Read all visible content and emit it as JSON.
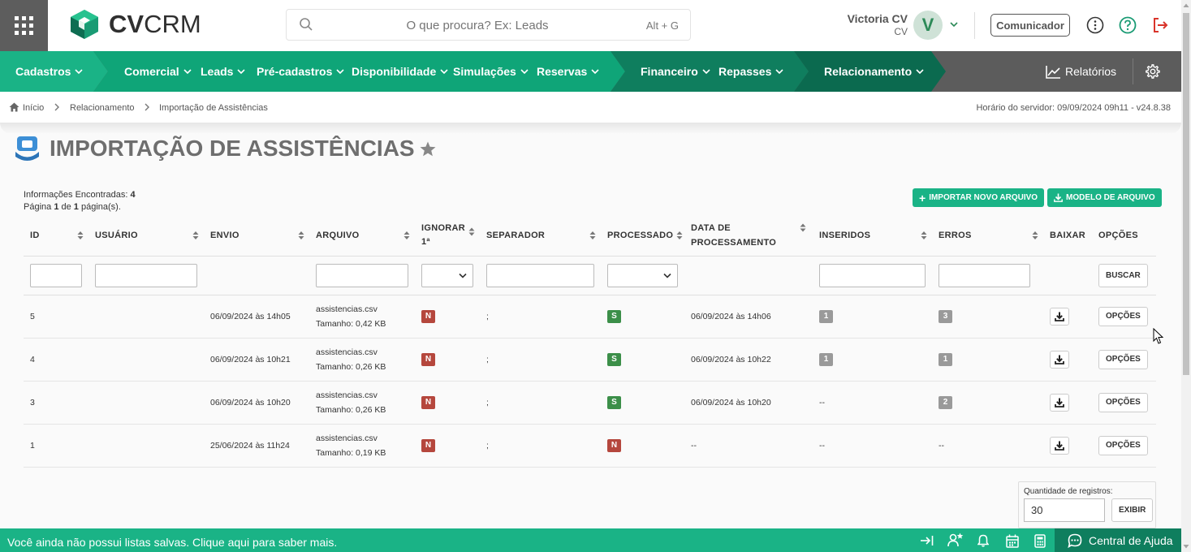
{
  "header": {
    "logo_text_bold": "CV",
    "logo_text_thin": "CRM",
    "search_placeholder": "O que procura? Ex: Leads",
    "search_shortcut": "Alt + G",
    "user_name": "Victoria CV",
    "user_sub": "CV",
    "avatar_letter": "V",
    "comunicador_label": "Comunicador"
  },
  "nav": {
    "cadastros": "Cadastros",
    "comercial": "Comercial",
    "leads": "Leads",
    "pre_cadastros": "Pré-cadastros",
    "disponibilidade": "Disponibilidade",
    "simulacoes": "Simulações",
    "reservas": "Reservas",
    "financeiro": "Financeiro",
    "repasses": "Repasses",
    "relacionamento": "Relacionamento",
    "relatorios": "Relatórios"
  },
  "breadcrumb": {
    "home": "Início",
    "section": "Relacionamento",
    "current": "Importação de Assistências",
    "server_time": "Horário do servidor: 09/09/2024 09h11 - v24.8.38"
  },
  "page": {
    "title": "IMPORTAÇÃO DE ASSISTÊNCIAS",
    "info_label": "Informações Encontradas: ",
    "info_count": "4",
    "page_prefix": "Página ",
    "page_num": "1",
    "page_mid": " de ",
    "page_total": "1",
    "page_suffix": " página(s).",
    "btn_import": "IMPORTAR NOVO ARQUIVO",
    "btn_model": "MODELO DE ARQUIVO"
  },
  "table": {
    "headers": {
      "id": "ID",
      "usuario": "USUÁRIO",
      "envio": "ENVIO",
      "arquivo": "ARQUIVO",
      "ignorar": "IGNORAR 1ª",
      "separador": "SEPARADOR",
      "processado": "PROCESSADO",
      "data_proc": "DATA DE PROCESSAMENTO",
      "inseridos": "INSERIDOS",
      "erros": "ERROS",
      "baixar": "BAIXAR",
      "opcoes": "OPÇÕES"
    },
    "buscar_label": "BUSCAR",
    "opcoes_label": "OPÇÕES",
    "rows": [
      {
        "id": "5",
        "envio": "06/09/2024 às 14h05",
        "arquivo": "assistencias.csv",
        "tamanho": "Tamanho: 0,42 KB",
        "ignorar": "N",
        "separador": ";",
        "processado": "S",
        "data_proc": "06/09/2024 às 14h06",
        "inseridos": "1",
        "erros": "3"
      },
      {
        "id": "4",
        "envio": "06/09/2024 às 10h21",
        "arquivo": "assistencias.csv",
        "tamanho": "Tamanho: 0,26 KB",
        "ignorar": "N",
        "separador": ";",
        "processado": "S",
        "data_proc": "06/09/2024 às 10h22",
        "inseridos": "1",
        "erros": "1"
      },
      {
        "id": "3",
        "envio": "06/09/2024 às 10h20",
        "arquivo": "assistencias.csv",
        "tamanho": "Tamanho: 0,26 KB",
        "ignorar": "N",
        "separador": ";",
        "processado": "S",
        "data_proc": "06/09/2024 às 10h20",
        "inseridos": "--",
        "erros": "2"
      },
      {
        "id": "1",
        "envio": "25/06/2024 às 11h24",
        "arquivo": "assistencias.csv",
        "tamanho": "Tamanho: 0,19 KB",
        "ignorar": "N",
        "separador": ";",
        "processado": "N",
        "data_proc": "--",
        "inseridos": "--",
        "erros": "--"
      }
    ]
  },
  "pagination": {
    "label": "Quantidade de registros:",
    "value": "30",
    "button": "EXIBIR"
  },
  "footer": {
    "message": "Você ainda não possui listas salvas. Clique aqui para saber mais.",
    "help": "Central de Ajuda"
  },
  "colors": {
    "brand_green": "#1ab386",
    "dark_green": "#0f7e5e",
    "nav_gray": "#5c5c5c",
    "badge_red": "#b5473d",
    "badge_green": "#3c8f49",
    "badge_gray": "#9a9a9a"
  }
}
